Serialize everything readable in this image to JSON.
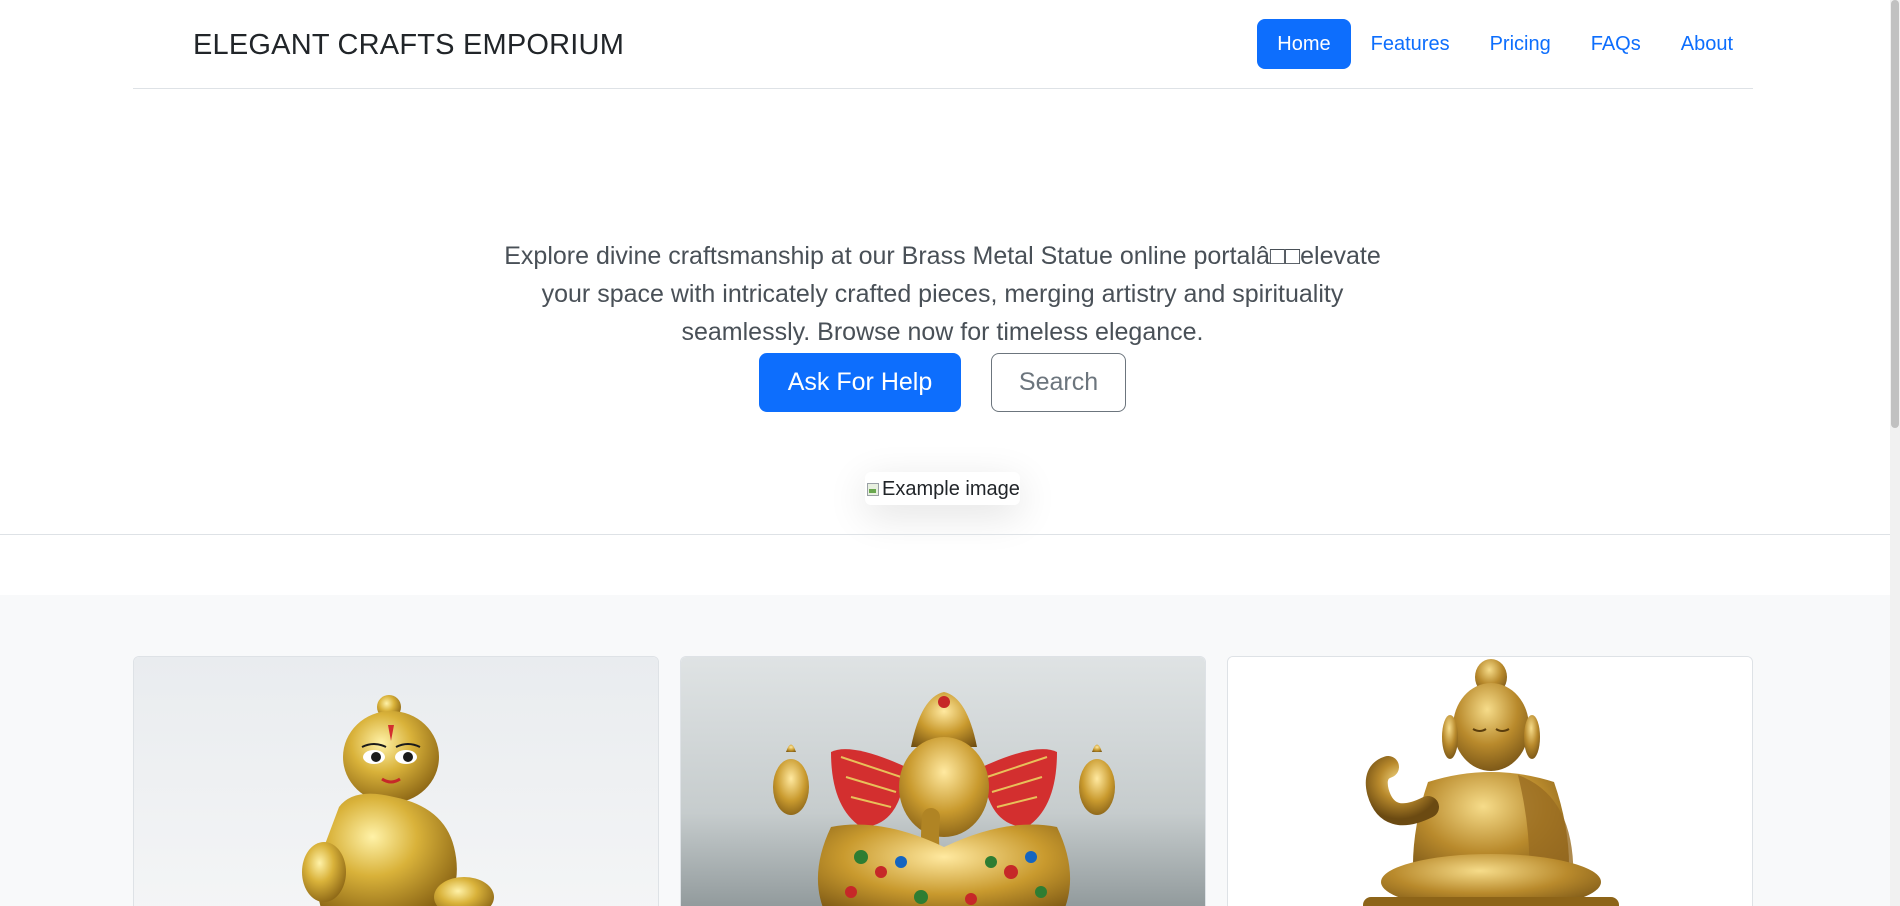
{
  "header": {
    "brand": "ELEGANT CRAFTS EMPORIUM",
    "nav": [
      {
        "label": "Home",
        "active": true
      },
      {
        "label": "Features",
        "active": false
      },
      {
        "label": "Pricing",
        "active": false
      },
      {
        "label": "FAQs",
        "active": false
      },
      {
        "label": "About",
        "active": false
      }
    ]
  },
  "hero": {
    "description": "Explore divine craftsmanship at our Brass Metal Statue online portalâ□□elevate your space with intricately crafted pieces, merging artistry and spirituality seamlessly. Browse now for timeless elegance.",
    "primary_button": "Ask For Help",
    "secondary_button": "Search",
    "image_alt": "Example image"
  },
  "cards": [
    {
      "icon": "brass-krishna-statue-image"
    },
    {
      "icon": "brass-ganesha-statue-image"
    },
    {
      "icon": "brass-buddha-statue-image"
    }
  ],
  "colors": {
    "primary": "#0d6efd",
    "secondary": "#6c757d",
    "section_bg": "#f8f9fa",
    "brass": "#c9a227"
  }
}
